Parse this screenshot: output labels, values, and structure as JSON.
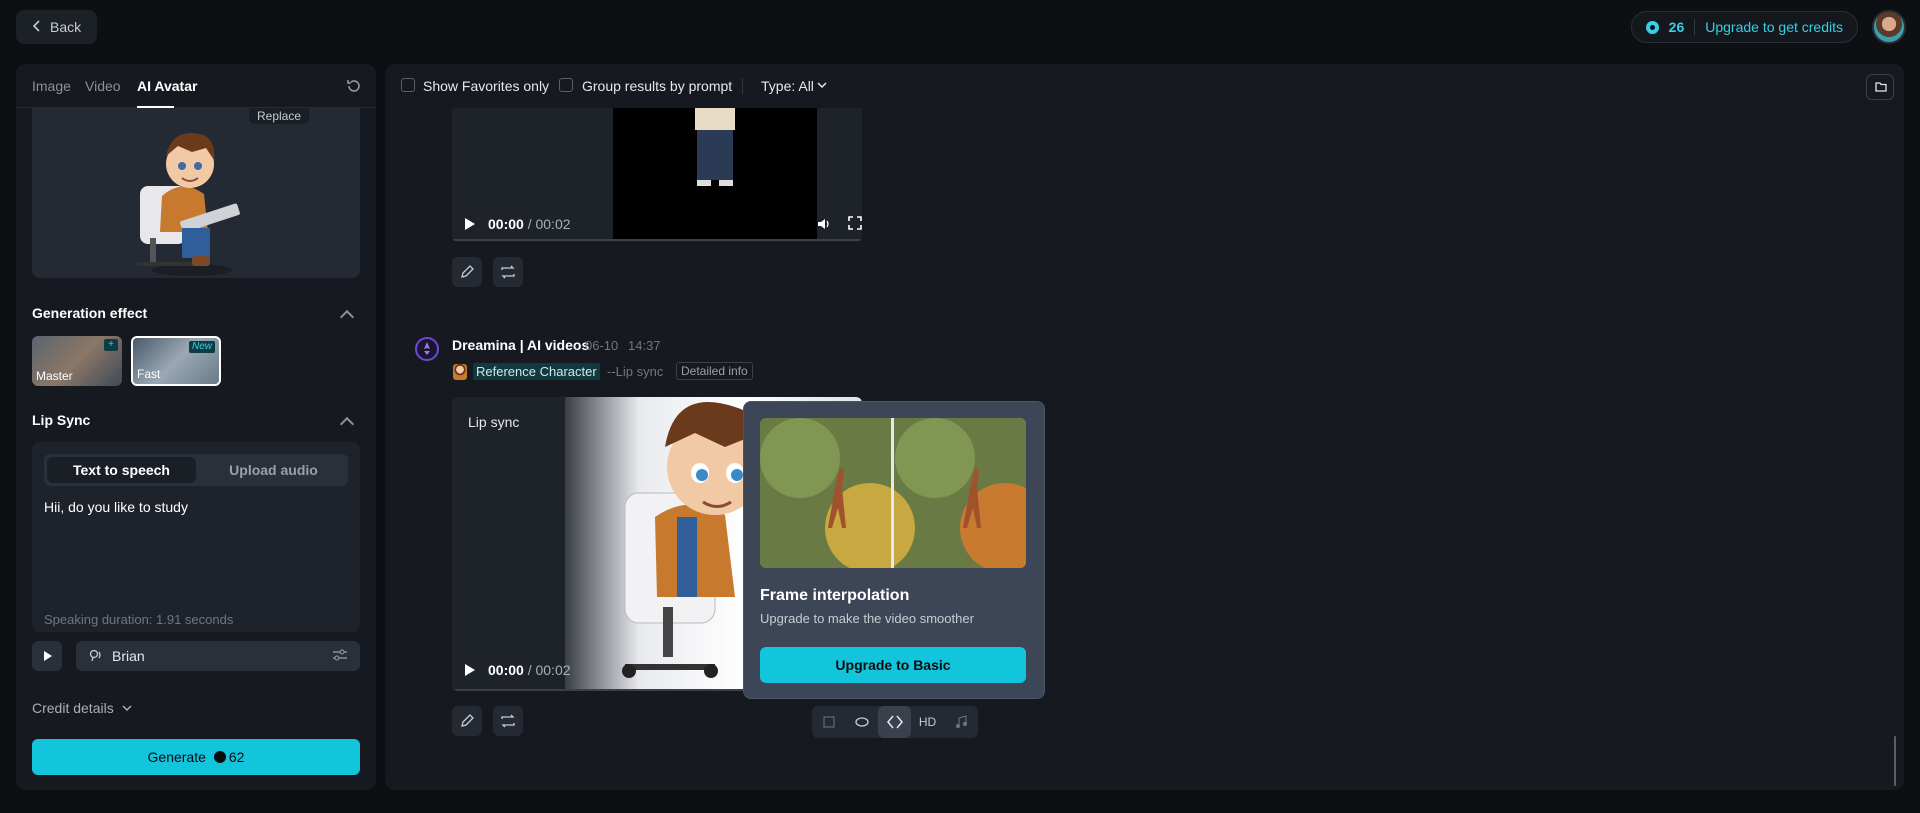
{
  "topbar": {
    "back_label": "Back",
    "credits": "26",
    "upgrade_label": "Upgrade to get credits"
  },
  "left": {
    "tabs": [
      "Image",
      "Video",
      "AI Avatar"
    ],
    "active_tab": "AI Avatar",
    "replace_label": "Replace",
    "generation_effect": {
      "title": "Generation effect",
      "options": [
        {
          "label": "Master",
          "badge": "+"
        },
        {
          "label": "Fast",
          "badge": "New"
        }
      ],
      "selected": "Fast"
    },
    "lip_sync": {
      "title": "Lip Sync",
      "modes": [
        "Text to speech",
        "Upload audio"
      ],
      "active_mode": "Text to speech",
      "text": "Hii, do you like to study",
      "duration": "Speaking duration: 1.91 seconds"
    },
    "voice": "Brian",
    "credit_details": "Credit details",
    "generate_label": "Generate",
    "generate_cost": "62"
  },
  "main": {
    "toolbar": {
      "favorites": "Show Favorites only",
      "group": "Group results by prompt",
      "type": "Type: All"
    },
    "video1": {
      "current": "00:00",
      "total": "/ 00:02"
    },
    "message": {
      "author": "Dreamina | AI videos",
      "date": "06-10",
      "time": "14:37",
      "ref_chip": "Reference Character",
      "tag": "--Lip sync",
      "detail": "Detailed info"
    },
    "video2": {
      "label": "Lip sync",
      "current": "00:00",
      "total": "/ 00:02"
    },
    "popup": {
      "title": "Frame interpolation",
      "subtitle": "Upgrade to make the video smoother",
      "button": "Upgrade to Basic"
    },
    "tools": {
      "hd_label": "HD"
    }
  }
}
